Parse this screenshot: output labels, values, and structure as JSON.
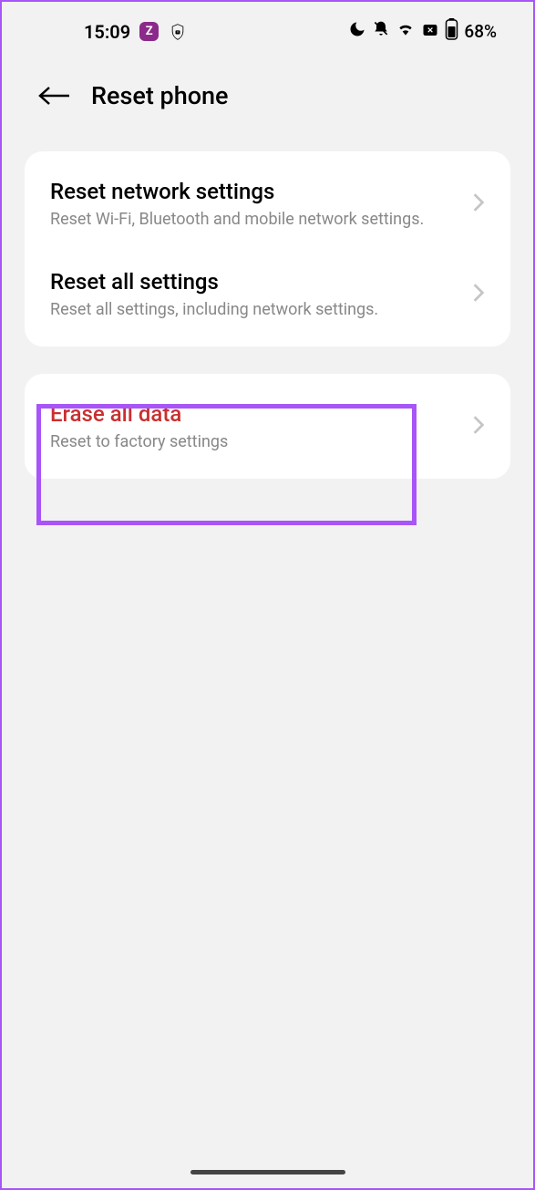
{
  "status_bar": {
    "time": "15:09",
    "battery_percent": "68%"
  },
  "header": {
    "title": "Reset phone"
  },
  "sections": [
    {
      "items": [
        {
          "title": "Reset network settings",
          "subtitle": "Reset Wi-Fi, Bluetooth and mobile network settings."
        },
        {
          "title": "Reset all settings",
          "subtitle": "Reset all settings, including network settings."
        }
      ]
    },
    {
      "items": [
        {
          "title": "Erase all data",
          "subtitle": "Reset to factory settings"
        }
      ]
    }
  ]
}
